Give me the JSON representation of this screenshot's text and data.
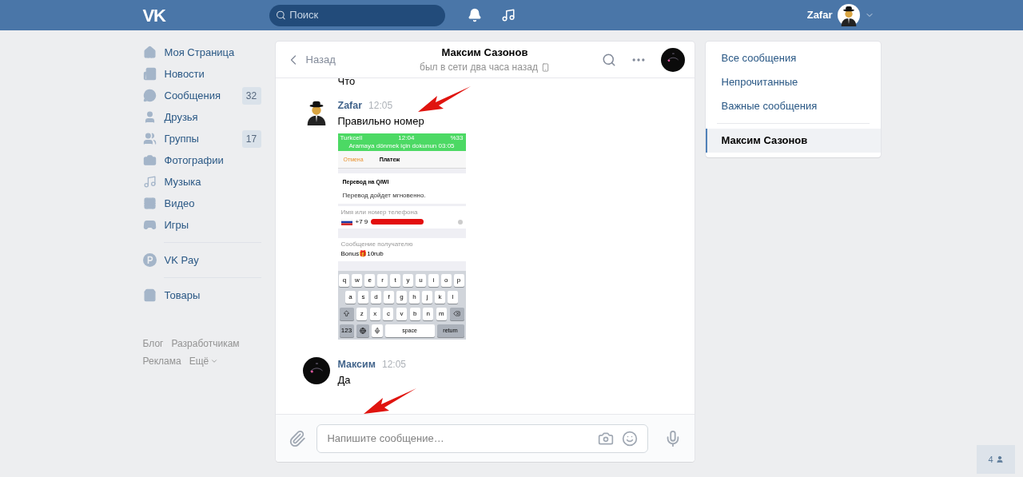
{
  "header": {
    "logo": "VK",
    "search": {
      "placeholder": "Поиск"
    },
    "user": {
      "name": "Zafar"
    }
  },
  "sidebar": {
    "sections": [
      [
        {
          "kind": "home",
          "label": "Моя Страница"
        },
        {
          "kind": "news",
          "label": "Новости"
        },
        {
          "kind": "messages",
          "label": "Сообщения",
          "count": "32"
        },
        {
          "kind": "friends",
          "label": "Друзья"
        },
        {
          "kind": "groups",
          "label": "Группы",
          "count": "17"
        },
        {
          "kind": "photos",
          "label": "Фотографии"
        },
        {
          "kind": "music",
          "label": "Музыка"
        },
        {
          "kind": "video",
          "label": "Видео"
        },
        {
          "kind": "games",
          "label": "Игры"
        }
      ],
      [
        {
          "kind": "pay",
          "label": "VK Pay"
        }
      ],
      [
        {
          "kind": "goods",
          "label": "Товары"
        }
      ]
    ],
    "footer": [
      [
        "Блог",
        "Разработчикам"
      ],
      [
        "Реклама",
        "Ещё"
      ]
    ]
  },
  "chat": {
    "back": "Назад",
    "title": "Максим Сазонов",
    "status": "был в сети два часа назад",
    "earlier_text": "Что",
    "messages": [
      {
        "author": "Zafar",
        "time": "12:05",
        "text": "Правильно номер",
        "attachment": {
          "carrier": "Turkcell",
          "clock": "12:04",
          "battery": "%33",
          "banner": "Aramaya dönmek için dokunun 03:05",
          "cancel": "Отмена",
          "title": "Платеж",
          "card_title": "Перевод на QIWI",
          "card_note": "Перевод дойдет мгновенно.",
          "phone_label": "Имя или номер телефона",
          "phone": "+7 9",
          "message_label": "Сообщение получателю",
          "message": "Bonus🎁10rub",
          "keyboard": [
            [
              {
                "kind": "letter",
                "label": "q"
              },
              {
                "kind": "letter",
                "label": "w"
              },
              {
                "kind": "letter",
                "label": "e"
              },
              {
                "kind": "letter",
                "label": "r"
              },
              {
                "kind": "letter",
                "label": "t"
              },
              {
                "kind": "letter",
                "label": "y"
              },
              {
                "kind": "letter",
                "label": "u"
              },
              {
                "kind": "letter",
                "label": "i"
              },
              {
                "kind": "letter",
                "label": "o"
              },
              {
                "kind": "letter",
                "label": "p"
              }
            ],
            [
              {
                "kind": "letter",
                "label": "a"
              },
              {
                "kind": "letter",
                "label": "s"
              },
              {
                "kind": "letter",
                "label": "d"
              },
              {
                "kind": "letter",
                "label": "f"
              },
              {
                "kind": "letter",
                "label": "g"
              },
              {
                "kind": "letter",
                "label": "h"
              },
              {
                "kind": "letter",
                "label": "j"
              },
              {
                "kind": "letter",
                "label": "k"
              },
              {
                "kind": "letter",
                "label": "l"
              }
            ],
            [
              {
                "kind": "shift"
              },
              {
                "kind": "letter",
                "label": "z"
              },
              {
                "kind": "letter",
                "label": "x"
              },
              {
                "kind": "letter",
                "label": "c"
              },
              {
                "kind": "letter",
                "label": "v"
              },
              {
                "kind": "letter",
                "label": "b"
              },
              {
                "kind": "letter",
                "label": "n"
              },
              {
                "kind": "letter",
                "label": "m"
              },
              {
                "kind": "backspace"
              }
            ],
            [
              {
                "kind": "function",
                "label": "123"
              },
              {
                "kind": "globe"
              },
              {
                "kind": "mic"
              },
              {
                "kind": "space",
                "label": "space"
              },
              {
                "kind": "return",
                "label": "return"
              }
            ]
          ]
        }
      },
      {
        "author": "Максим",
        "time": "12:05",
        "text": "Да"
      }
    ],
    "composer": {
      "placeholder": "Напишите сообщение…"
    }
  },
  "filters": [
    {
      "label": "Все сообщения",
      "selected": false
    },
    {
      "label": "Непрочитанные",
      "selected": false
    },
    {
      "label": "Важные сообщения",
      "selected": false
    },
    {
      "label": "Максим Сазонов",
      "selected": true
    }
  ],
  "online_widget": {
    "count": "4"
  }
}
